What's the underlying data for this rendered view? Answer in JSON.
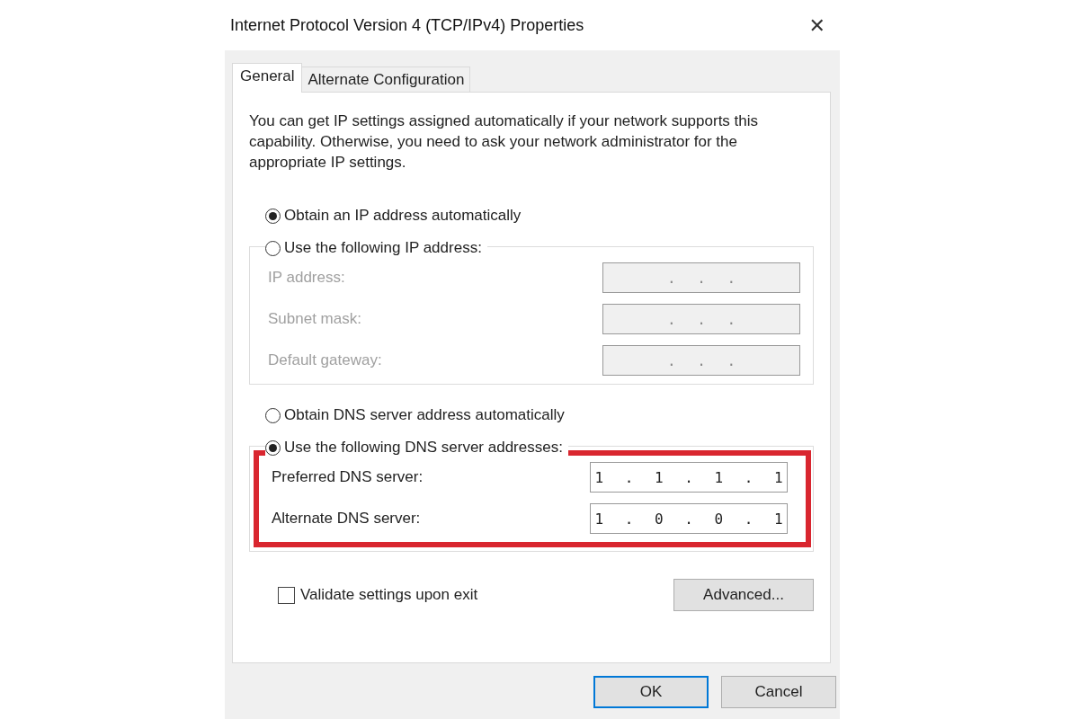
{
  "window": {
    "title": "Internet Protocol Version 4 (TCP/IPv4) Properties",
    "close": "✕"
  },
  "tabs": [
    {
      "label": "General",
      "selected": true
    },
    {
      "label": "Alternate Configuration",
      "selected": false
    }
  ],
  "description": "You can get IP settings assigned automatically if your network supports this capability. Otherwise, you need to ask your network administrator for the appropriate IP settings.",
  "ip_options": [
    {
      "label": "Obtain an IP address automatically",
      "selected": true
    },
    {
      "label": "Use the following IP address:",
      "selected": false
    }
  ],
  "ip_fields": [
    {
      "label": "IP address:",
      "value": ". . .",
      "disabled": true
    },
    {
      "label": "Subnet mask:",
      "value": ". . .",
      "disabled": true
    },
    {
      "label": "Default gateway:",
      "value": ". . .",
      "disabled": true
    }
  ],
  "dns_options": [
    {
      "label": "Obtain DNS server address automatically",
      "selected": false
    },
    {
      "label": "Use the following DNS server addresses:",
      "selected": true
    }
  ],
  "dns_highlighted": true,
  "dns_fields": [
    {
      "label": "Preferred DNS server:",
      "value": "1 . 1 . 1 . 1",
      "disabled": false
    },
    {
      "label": "Alternate DNS server:",
      "value": "1 . 0 . 0 . 1",
      "disabled": false
    }
  ],
  "validate": {
    "label": "Validate settings upon exit",
    "checked": false
  },
  "advanced_button": "Advanced...",
  "buttons": [
    {
      "label": "OK",
      "default": true
    },
    {
      "label": "Cancel",
      "default": false
    }
  ]
}
